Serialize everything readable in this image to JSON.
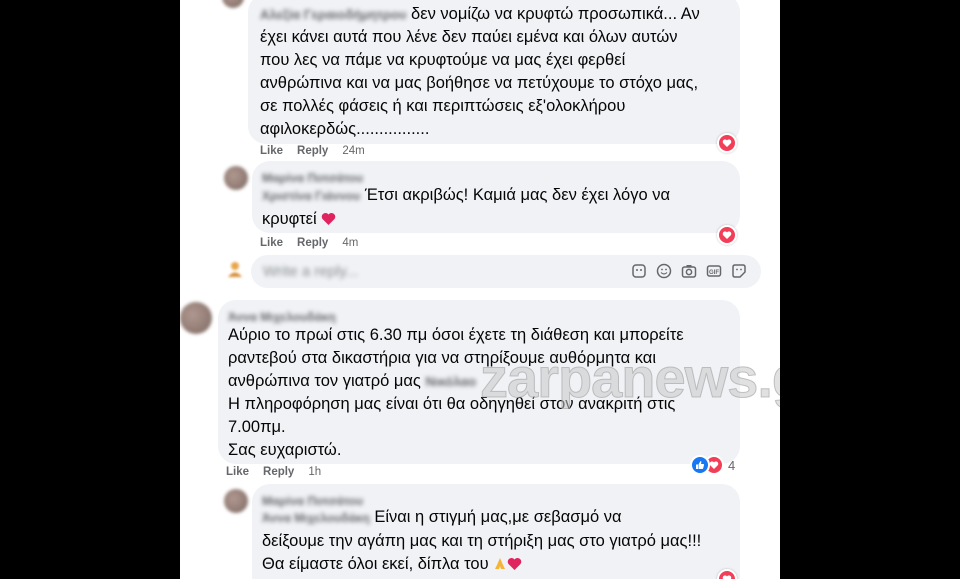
{
  "comments": [
    {
      "author_blurred": "Αλεξία Γεραιοδήμητρου",
      "text_lines": [
        "δεν νομίζω να κρυφτώ προσωπικά... Αν",
        "έχει κάνει αυτά που λένε δεν παύει εμένα και όλων αυτών",
        "που λες να πάμε να κρυφτούμε να μας έχει φερθεί",
        "ανθρώπινα και να μας βοήθησε να πετύχουμε το στόχο μας,",
        "σε πολλές φάσεις ή και περιπτώσεις εξ'ολοκλήρου",
        "αφιλοκερδώς................"
      ],
      "like": "Like",
      "reply": "Reply",
      "time": "24m"
    },
    {
      "author_blurred": "Μαρίνα Ποτσάτου",
      "mention_blurred": "Χριστίνα Γιάννου",
      "text_line1": "Έτσι ακριβώς! Καμιά μας δεν έχει λόγο να",
      "text_line2": "κρυφτεί",
      "like": "Like",
      "reply": "Reply",
      "time": "4m"
    },
    {
      "author_blurred": "Άννα Μιχελουδάκη",
      "text_lines": [
        "Αύριο το πρωί στις 6.30 πμ όσοι έχετε τη διάθεση και μπορείτε",
        "ραντεβού στα δικαστήρια για να στηρίξουμε αυθόρμητα και",
        "ανθρώπινα τον γιατρό μας",
        "Η πληροφόρηση μας είναι ότι θα οδηγηθεί στον ανακριτή στις",
        "7.00πμ.",
        "Σας ευχαριστώ."
      ],
      "mention_blurred": "Νικόλαο",
      "like": "Like",
      "reply": "Reply",
      "time": "1h",
      "reaction_count": "4"
    },
    {
      "author_blurred": "Μαρίνα Ποτσάτου",
      "mention_blurred": "Άννα Μιχελουδάκη",
      "text_line1": "Είναι η στιγμή μας,με σεβασμό να",
      "text_line2": "δείξουμε την αγάπη μας και τη στήριξη μας στο γιατρό μας!!!",
      "text_line3": "Θα είμαστε όλοι εκεί, δίπλα του"
    }
  ],
  "reply_box": {
    "placeholder": "Write a reply..."
  },
  "watermark": "zarpanews.gr",
  "colors": {
    "heart": "#f33e58",
    "like_blue": "#1877f2",
    "bubble": "#f0f2f5"
  }
}
